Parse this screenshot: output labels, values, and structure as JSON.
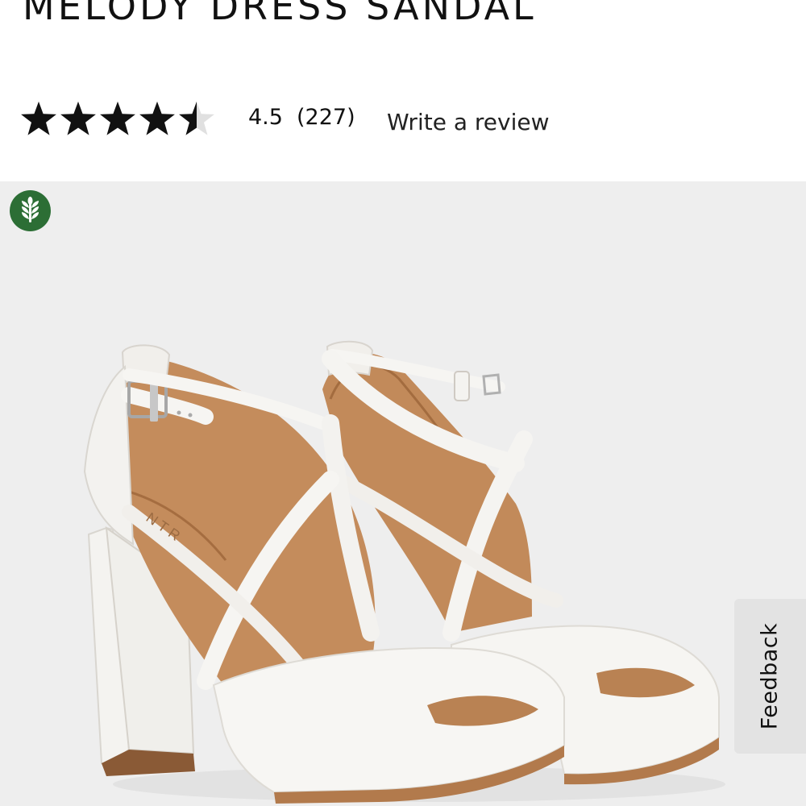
{
  "product": {
    "title": "MELODY DRESS SANDAL"
  },
  "rating": {
    "value": "4.5",
    "count": "(227)",
    "stars_filled": 4.5,
    "stars_total": 5,
    "write_review_label": "Write a review",
    "star_color": "#111111",
    "star_empty_color": "#e0e0e0"
  },
  "gallery": {
    "background_color": "#eeeeee",
    "badge_icon": "wheat-leaf-icon",
    "badge_color": "#2c6e35"
  },
  "feedback": {
    "label": "Feedback"
  }
}
